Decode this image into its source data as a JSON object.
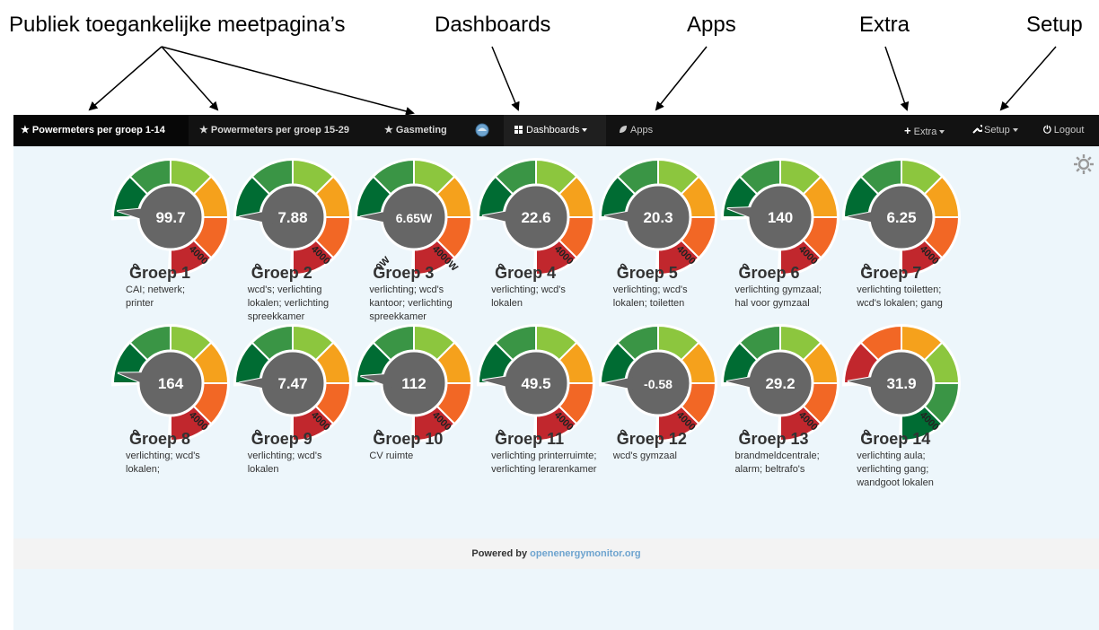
{
  "annotations": [
    {
      "label": "Publiek toegankelijke meetpagina’s"
    },
    {
      "label": "Dashboards"
    },
    {
      "label": "Apps"
    },
    {
      "label": "Extra"
    },
    {
      "label": "Setup"
    }
  ],
  "nav": {
    "powermeters_1": "★ Powermeters per groep 1-14",
    "powermeters_2": "★ Powermeters per groep 15-29",
    "gasmeting": "★ Gasmeting",
    "dashboards": "Dashboards",
    "apps": "Apps",
    "extra": "Extra",
    "setup": "Setup",
    "logout": "Logout"
  },
  "gauge_scale": {
    "min_label": "0",
    "max_label": "4000"
  },
  "gauges": [
    {
      "value": "99.7",
      "title": "Groep 1",
      "desc": [
        "CAI; netwerk;",
        "printer"
      ]
    },
    {
      "value": "7.88",
      "title": "Groep 2",
      "desc": [
        "wcd's; verlichting",
        "lokalen; verlichting",
        "spreekkamer"
      ]
    },
    {
      "value": "6.65W",
      "title": "Groep 3",
      "desc": [
        "verlichting; wcd's",
        "kantoor; verlichting",
        "spreekkamer"
      ],
      "min_label": "0W",
      "max_label": "4000W"
    },
    {
      "value": "22.6",
      "title": "Groep 4",
      "desc": [
        "verlichting; wcd's",
        "lokalen"
      ]
    },
    {
      "value": "20.3",
      "title": "Groep 5",
      "desc": [
        "verlichting; wcd's",
        "lokalen; toiletten"
      ]
    },
    {
      "value": "140",
      "title": "Groep 6",
      "desc": [
        "verlichting gymzaal;",
        "hal voor gymzaal"
      ]
    },
    {
      "value": "6.25",
      "title": "Groep 7",
      "desc": [
        "verlichting toiletten;",
        "wcd's lokalen; gang"
      ]
    },
    {
      "value": "164",
      "title": "Groep 8",
      "desc": [
        "verlichting; wcd's",
        "lokalen;"
      ]
    },
    {
      "value": "7.47",
      "title": "Groep 9",
      "desc": [
        "verlichting; wcd's",
        "lokalen"
      ]
    },
    {
      "value": "112",
      "title": "Groep 10",
      "desc": [
        "CV ruimte"
      ]
    },
    {
      "value": "49.5",
      "title": "Groep 11",
      "desc": [
        "verlichting printerruimte;",
        "verlichting lerarenkamer"
      ]
    },
    {
      "value": "-0.58",
      "title": "Groep 12",
      "desc": [
        "wcd's gymzaal"
      ]
    },
    {
      "value": "29.2",
      "title": "Groep 13",
      "desc": [
        "brandmeldcentrale;",
        "alarm; beltrafo's"
      ]
    },
    {
      "value": "31.9",
      "title": "Groep 14",
      "desc": [
        "verlichting aula;",
        "verlichting gang;",
        "wandgoot lokalen"
      ],
      "reversed": true
    }
  ],
  "gauge_colors": [
    "#006c33",
    "#3a9545",
    "#8cc63e",
    "#f5a11c",
    "#f26725",
    "#c1272d"
  ],
  "footer": {
    "prefix": "Powered by",
    "link": "openenergymonitor.org"
  }
}
